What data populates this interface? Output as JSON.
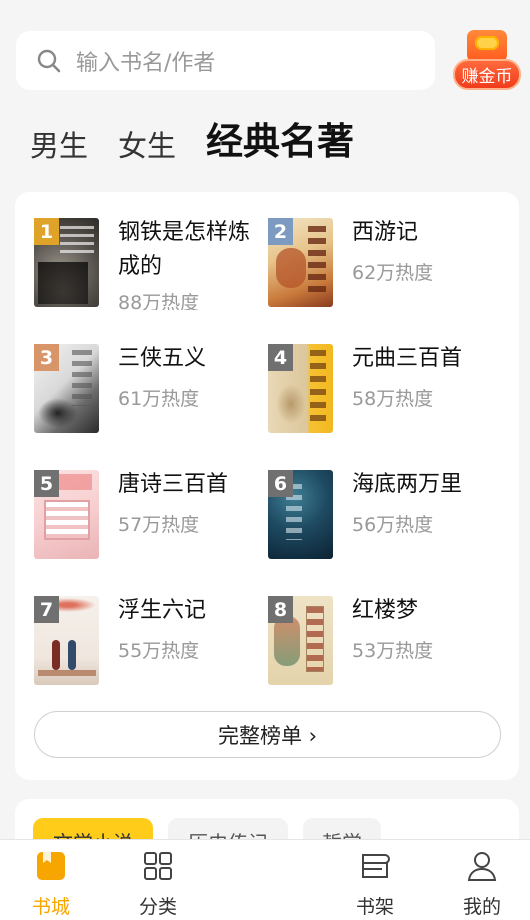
{
  "search": {
    "placeholder": "输入书名/作者"
  },
  "earn_coins": {
    "label": "赚金币"
  },
  "tabs": [
    {
      "label": "男生",
      "active": false
    },
    {
      "label": "女生",
      "active": false
    },
    {
      "label": "经典名著",
      "active": true
    }
  ],
  "ranking": {
    "books": [
      {
        "rank": "1",
        "title": "钢铁是怎样炼成的",
        "heat": "88万热度",
        "rank_color": "#e0a32a"
      },
      {
        "rank": "2",
        "title": "西游记",
        "heat": "62万热度",
        "rank_color": "#7d9bc0"
      },
      {
        "rank": "3",
        "title": "三侠五义",
        "heat": "61万热度",
        "rank_color": "#d89668"
      },
      {
        "rank": "4",
        "title": "元曲三百首",
        "heat": "58万热度",
        "rank_color": "#707070"
      },
      {
        "rank": "5",
        "title": "唐诗三百首",
        "heat": "57万热度",
        "rank_color": "#707070"
      },
      {
        "rank": "6",
        "title": "海底两万里",
        "heat": "56万热度",
        "rank_color": "#707070"
      },
      {
        "rank": "7",
        "title": "浮生六记",
        "heat": "55万热度",
        "rank_color": "#707070"
      },
      {
        "rank": "8",
        "title": "红楼梦",
        "heat": "53万热度",
        "rank_color": "#707070"
      }
    ],
    "full_list_label": "完整榜单 ›"
  },
  "category_chips": [
    {
      "label": "文学小说",
      "active": true
    },
    {
      "label": "历史传记",
      "active": false
    },
    {
      "label": "哲学",
      "active": false
    }
  ],
  "bottom_nav": [
    {
      "label": "书城",
      "icon": "bookstore-icon",
      "active": true
    },
    {
      "label": "分类",
      "icon": "category-grid-icon",
      "active": false
    },
    {
      "label": "书架",
      "icon": "bookshelf-icon",
      "active": false
    },
    {
      "label": "我的",
      "icon": "profile-icon",
      "active": false
    }
  ],
  "colors": {
    "accent": "#f7a600",
    "earn_red": "#f03c1c"
  }
}
